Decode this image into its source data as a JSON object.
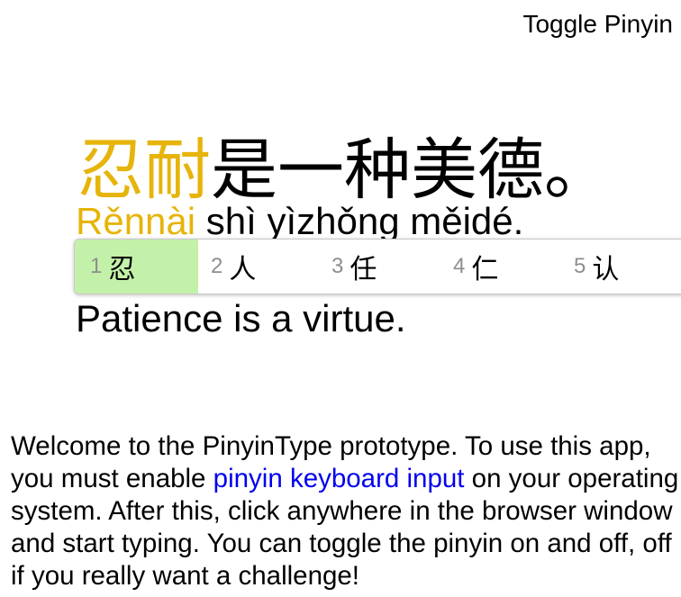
{
  "header": {
    "toggle_pinyin_label": "Toggle Pinyin"
  },
  "sentence": {
    "hanzi_typed": "忍耐",
    "hanzi_rest": "是一种美德。",
    "pinyin_typed": "Rěnnài",
    "pinyin_rest": " shì yìzhǒng měidé.",
    "translation": "Patience is a virtue."
  },
  "candidates": [
    {
      "num": "1",
      "char": "忍",
      "selected": true
    },
    {
      "num": "2",
      "char": "人",
      "selected": false
    },
    {
      "num": "3",
      "char": "任",
      "selected": false
    },
    {
      "num": "4",
      "char": "仁",
      "selected": false
    },
    {
      "num": "5",
      "char": "认",
      "selected": false
    }
  ],
  "welcome": {
    "before_link": "Welcome to the PinyinType prototype. To use this app, you must enable ",
    "link_text": "pinyin keyboard input",
    "after_link": " on your operating system. After this, click anywhere in the browser window and start typing. You can toggle the pinyin on and off, off if you really want a challenge!"
  },
  "colors": {
    "typed_text": "#e6b40a",
    "selected_candidate_bg": "#c4f1a9",
    "link": "#0000ee"
  }
}
